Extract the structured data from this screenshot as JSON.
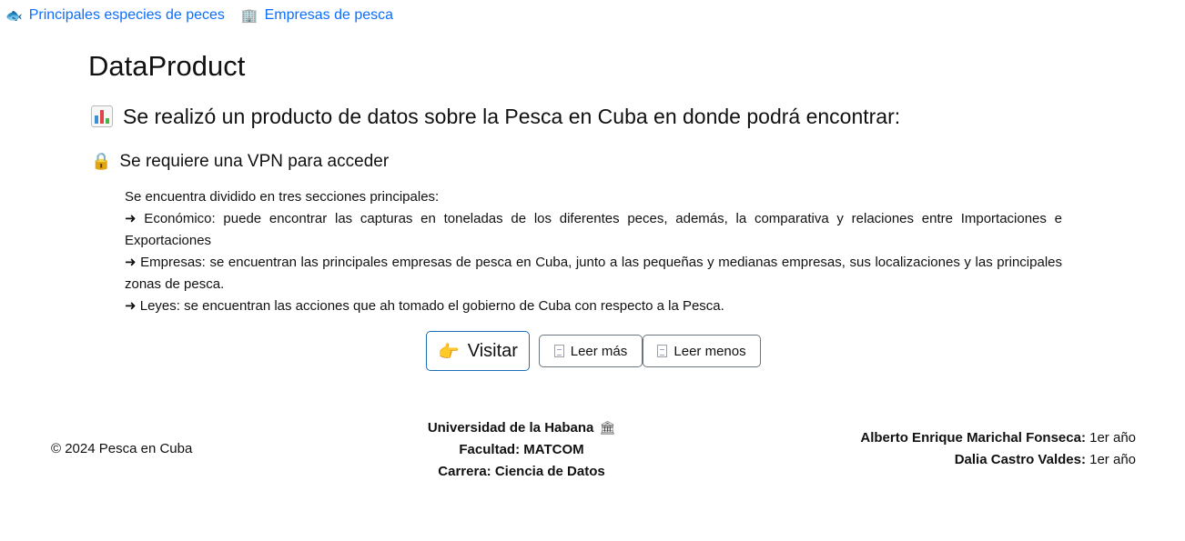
{
  "nav": {
    "items": [
      {
        "label": "Principales especies de peces",
        "icon": "fish-icon"
      },
      {
        "label": "Empresas de pesca",
        "icon": "office-building-icon"
      }
    ]
  },
  "main": {
    "title": "DataProduct",
    "heading": "Se realizó un producto de datos sobre la Pesca en Cuba en donde podrá encontrar:",
    "heading_icon": "bar-chart-icon",
    "vpn_notice": "Se requiere una VPN para acceder",
    "vpn_icon": "lock-icon",
    "description": [
      "Se encuentra dividido en tres secciones principales:",
      "➜ Económico: puede encontrar las capturas en toneladas de los diferentes peces, además, la comparativa y relaciones entre Importaciones e Exportaciones",
      "➜ Empresas: se encuentran las principales empresas de pesca en Cuba, junto a las pequeñas y medianas empresas, sus localizaciones y las principales zonas de pesca.",
      "➜ Leyes: se encuentran las acciones que ah tomado el gobierno de Cuba con respecto a la Pesca."
    ]
  },
  "buttons": {
    "visit": {
      "label": "Visitar",
      "icon": "pointing-hand-icon"
    },
    "read_more": {
      "label": "Leer más",
      "icon": "page-icon"
    },
    "read_less": {
      "label": "Leer menos",
      "icon": "page-icon"
    }
  },
  "footer": {
    "copyright": "© 2024 Pesca en Cuba",
    "university": "Universidad de la Habana",
    "university_icon": "classical-building-icon",
    "faculty": "Facultad: MATCOM",
    "career": "Carrera: Ciencia de Datos",
    "authors": [
      {
        "name": "Alberto Enrique Marichal Fonseca:",
        "year": "1er año"
      },
      {
        "name": "Dalia Castro Valdes:",
        "year": "1er año"
      }
    ]
  },
  "colors": {
    "link": "#0d6efd",
    "visit_border": "#1f6fb8",
    "button_border": "#6c757d",
    "text": "#111111"
  }
}
